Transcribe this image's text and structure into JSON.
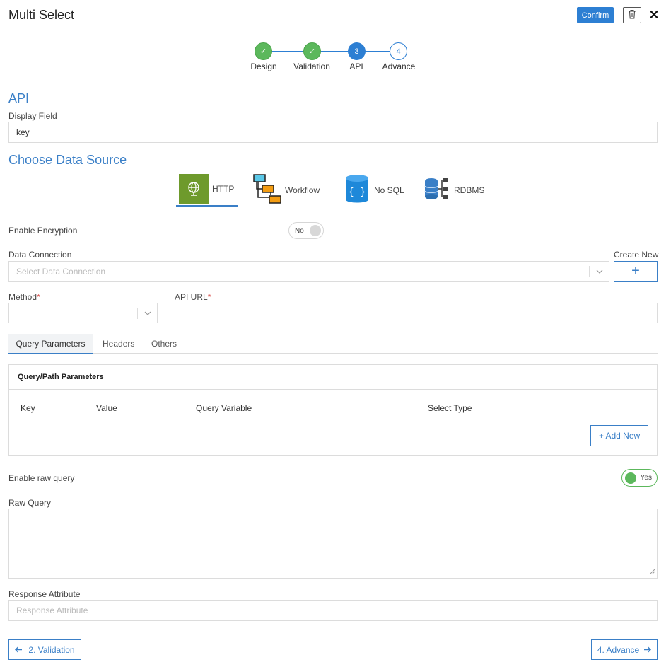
{
  "header": {
    "title": "Multi Select",
    "confirm_label": "Confirm",
    "close_glyph": "✕"
  },
  "stepper": {
    "steps": [
      {
        "label": "Design",
        "state": "done",
        "marker": "✓"
      },
      {
        "label": "Validation",
        "state": "done",
        "marker": "✓"
      },
      {
        "label": "API",
        "state": "active",
        "marker": "3"
      },
      {
        "label": "Advance",
        "state": "todo",
        "marker": "4"
      }
    ]
  },
  "api": {
    "section_title": "API",
    "display_field_label": "Display Field",
    "display_field_value": "key"
  },
  "data_source": {
    "section_title": "Choose Data Source",
    "options": [
      {
        "label": "HTTP",
        "icon": "globe-icon",
        "selected": true
      },
      {
        "label": "Workflow",
        "icon": "workflow-icon",
        "selected": false
      },
      {
        "label": "No SQL",
        "icon": "nosql-icon",
        "selected": false
      },
      {
        "label": "RDBMS",
        "icon": "rdbms-icon",
        "selected": false
      }
    ]
  },
  "encryption": {
    "label": "Enable Encryption",
    "toggle_text": "No",
    "enabled": false
  },
  "connection": {
    "label": "Data Connection",
    "placeholder": "Select Data Connection",
    "create_new_label": "Create New",
    "create_glyph": "+"
  },
  "method": {
    "label": "Method",
    "required_mark": "*",
    "value": ""
  },
  "api_url": {
    "label": "API URL",
    "required_mark": "*",
    "value": ""
  },
  "tabs": [
    {
      "label": "Query Parameters",
      "active": true
    },
    {
      "label": "Headers",
      "active": false
    },
    {
      "label": "Others",
      "active": false
    }
  ],
  "params_panel": {
    "title": "Query/Path Parameters",
    "columns": [
      "Key",
      "Value",
      "Query Variable",
      "Select Type"
    ],
    "add_new_label": "+ Add New"
  },
  "raw_query": {
    "toggle_label": "Enable raw query",
    "toggle_text": "Yes",
    "enabled": true,
    "field_label": "Raw Query",
    "value": ""
  },
  "response_attribute": {
    "label": "Response Attribute",
    "placeholder": "Response Attribute"
  },
  "footer": {
    "prev_label": "2. Validation",
    "next_label": "4. Advance"
  },
  "colors": {
    "accent": "#3a7fc7",
    "primary_button": "#2d7fd3",
    "success": "#5cb85c",
    "http_tile": "#6e9a2c"
  }
}
